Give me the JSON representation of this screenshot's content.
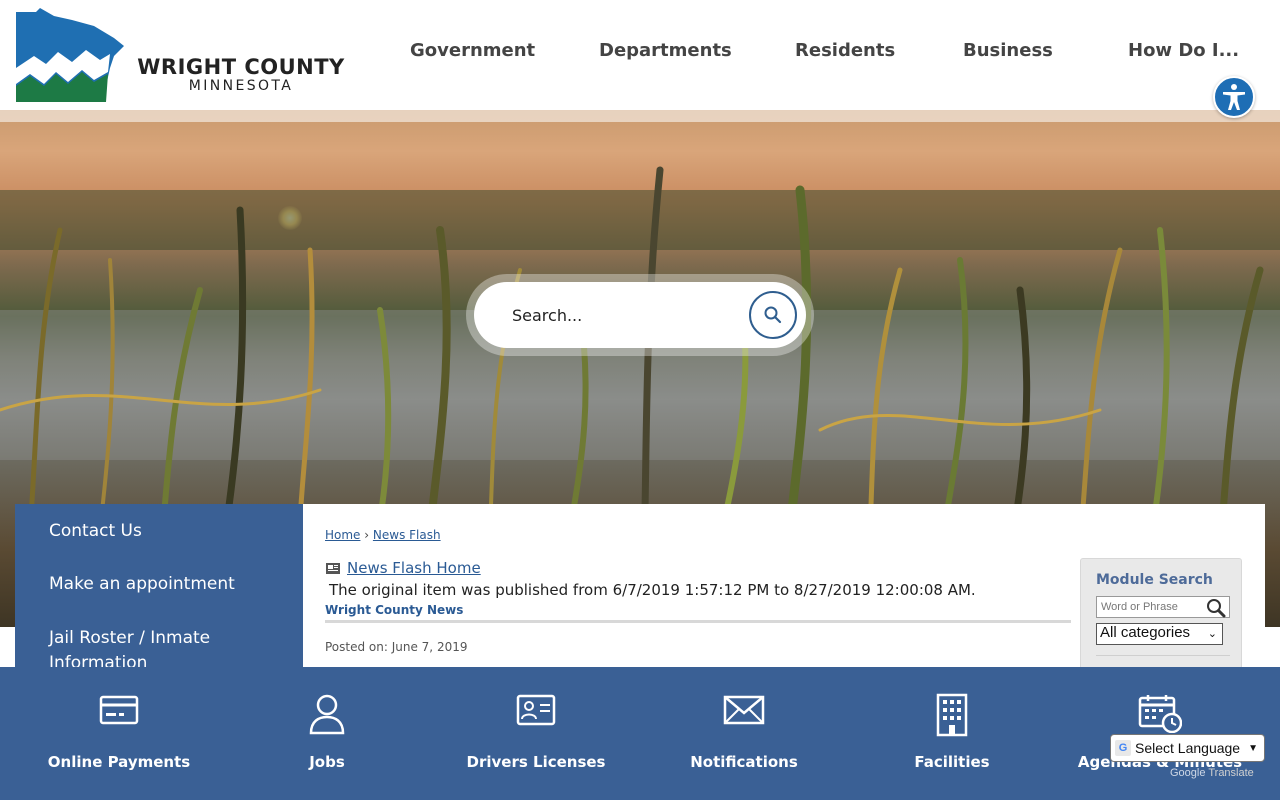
{
  "site": {
    "logo_title": "WRIGHT COUNTY",
    "logo_subtitle": "MINNESOTA"
  },
  "nav": {
    "items": [
      "Government",
      "Departments",
      "Residents",
      "Business",
      "How Do I..."
    ]
  },
  "hero": {
    "search_placeholder": "Search..."
  },
  "sidebar": {
    "items": [
      "Contact Us",
      "Make an appointment",
      "Jail Roster / Inmate Information"
    ]
  },
  "breadcrumb": {
    "home": "Home",
    "separator": "›",
    "current": "News Flash"
  },
  "article": {
    "home_link": "News Flash Home",
    "published_note": "The original item was published from 6/7/2019 1:57:12 PM to 8/27/2019 12:00:08 AM.",
    "category": "Wright County News",
    "posted_on": "Posted on: June 7, 2019"
  },
  "module_search": {
    "title": "Module Search",
    "input_placeholder": "Word or Phrase",
    "select_value": "All categories"
  },
  "quick_links": [
    {
      "label": "Online Payments",
      "icon": "credit-card-icon"
    },
    {
      "label": "Jobs",
      "icon": "person-icon"
    },
    {
      "label": "Drivers Licenses",
      "icon": "id-card-icon"
    },
    {
      "label": "Notifications",
      "icon": "envelope-icon"
    },
    {
      "label": "Facilities",
      "icon": "building-icon"
    },
    {
      "label": "Agendas & Minutes",
      "icon": "calendar-clock-icon"
    }
  ],
  "translate": {
    "select_label": "Select Language",
    "powered_by": "Google",
    "powered_suffix": "Translate"
  },
  "colors": {
    "brand_blue": "#3a6095",
    "link_blue": "#2a5a94",
    "logo_blue": "#1f6fb2",
    "logo_green": "#1d7a45"
  }
}
